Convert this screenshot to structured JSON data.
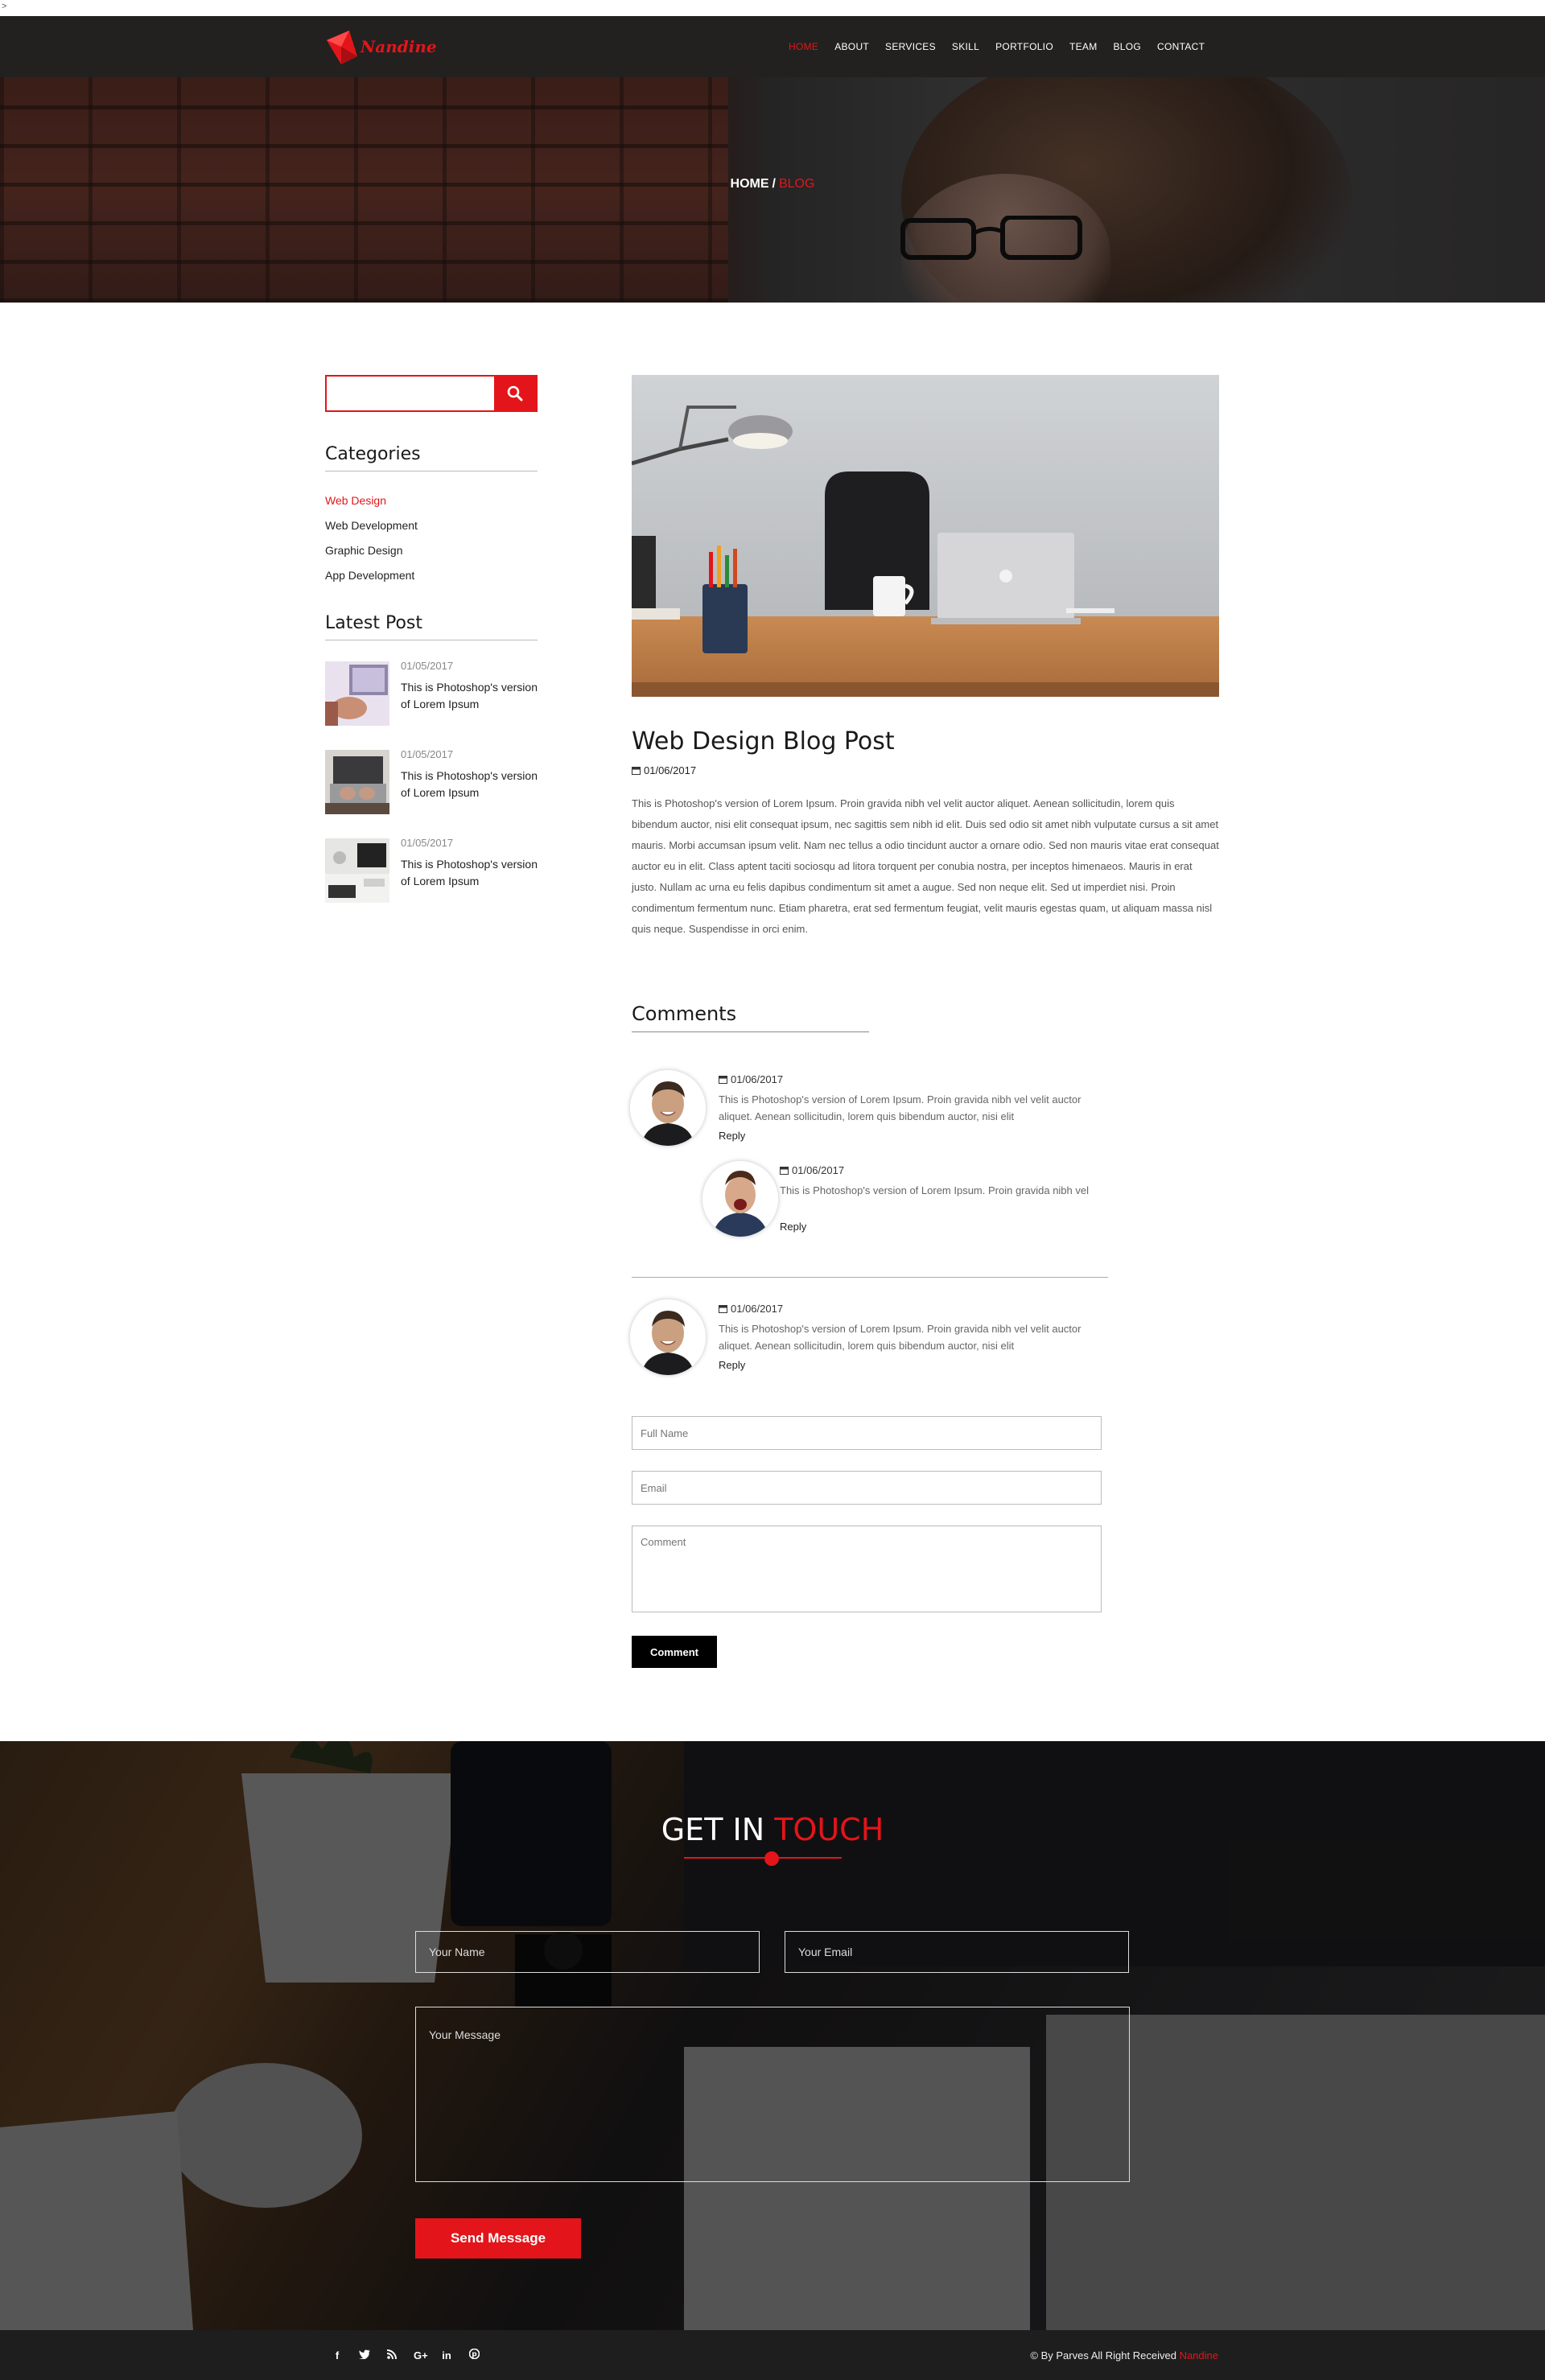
{
  "stray_char": ">",
  "brand": {
    "name": "Nandine"
  },
  "nav": {
    "items": [
      "HOME",
      "ABOUT",
      "SERVICES",
      "SKILL",
      "PORTFOLIO",
      "TEAM",
      "BLOG",
      "CONTACT"
    ],
    "active": "HOME"
  },
  "hero": {
    "crumb_home": "HOME",
    "crumb_sep": "/",
    "crumb_current": "BLOG"
  },
  "sidebar": {
    "search": {
      "placeholder": "",
      "icon": "search-icon"
    },
    "categories_title": "Categories",
    "categories": [
      "Web Design",
      "Web Development",
      "Graphic Design",
      "App Development"
    ],
    "active_category": "Web Design",
    "latest_title": "Latest Post",
    "latest": [
      {
        "date": "01/05/2017",
        "title": "This is Photoshop's version of Lorem Ipsum"
      },
      {
        "date": "01/05/2017",
        "title": "This is Photoshop's version of Lorem Ipsum"
      },
      {
        "date": "01/05/2017",
        "title": "This is Photoshop's version of Lorem Ipsum"
      }
    ]
  },
  "post": {
    "title": "Web Design Blog Post",
    "date": "01/06/2017",
    "body": "This is Photoshop's version of Lorem Ipsum. Proin gravida nibh vel velit auctor aliquet. Aenean sollicitudin, lorem quis bibendum auctor, nisi elit consequat ipsum, nec sagittis sem nibh id elit. Duis sed odio sit amet nibh vulputate cursus a sit amet mauris. Morbi accumsan ipsum velit. Nam nec tellus a odio tincidunt auctor a ornare odio. Sed non mauris vitae erat consequat auctor eu in elit. Class aptent taciti sociosqu ad litora torquent per conubia nostra, per inceptos himenaeos. Mauris in erat justo. Nullam ac urna eu felis dapibus condimentum sit amet a augue. Sed non neque elit. Sed ut imperdiet nisi. Proin condimentum fermentum nunc. Etiam pharetra, erat sed fermentum feugiat, velit mauris egestas quam, ut aliquam massa nisl quis neque. Suspendisse in orci enim."
  },
  "comments": {
    "title": "Comments",
    "list": [
      {
        "date": "01/06/2017",
        "text": "This is Photoshop's version of Lorem Ipsum. Proin gravida nibh vel velit auctor aliquet. Aenean sollicitudin, lorem quis bibendum auctor, nisi elit",
        "reply": "Reply"
      },
      {
        "date": "01/06/2017",
        "text": "This is Photoshop's version of Lorem Ipsum. Proin gravida nibh vel",
        "reply": "Reply"
      },
      {
        "date": "01/06/2017",
        "text": "This is Photoshop's version of Lorem Ipsum. Proin gravida nibh vel velit auctor aliquet. Aenean sollicitudin, lorem quis bibendum auctor, nisi elit",
        "reply": "Reply"
      }
    ],
    "form": {
      "name_placeholder": "Full Name",
      "email_placeholder": "Email",
      "comment_placeholder": "Comment",
      "submit": "Comment"
    }
  },
  "contact": {
    "title_main": "GET IN",
    "title_accent": "TOUCH",
    "name_placeholder": "Your Name",
    "email_placeholder": "Your Email",
    "message_placeholder": "Your Message",
    "submit": "Send Message"
  },
  "footer": {
    "social": [
      "f",
      "t",
      "rss",
      "G+",
      "in",
      "p"
    ],
    "copy_prefix": "© By Parves All Right Received",
    "copy_brand": "Nandine"
  },
  "colors": {
    "accent": "#e3151a",
    "nav_bg": "#222120",
    "footer_bg": "#1f1e1e"
  }
}
